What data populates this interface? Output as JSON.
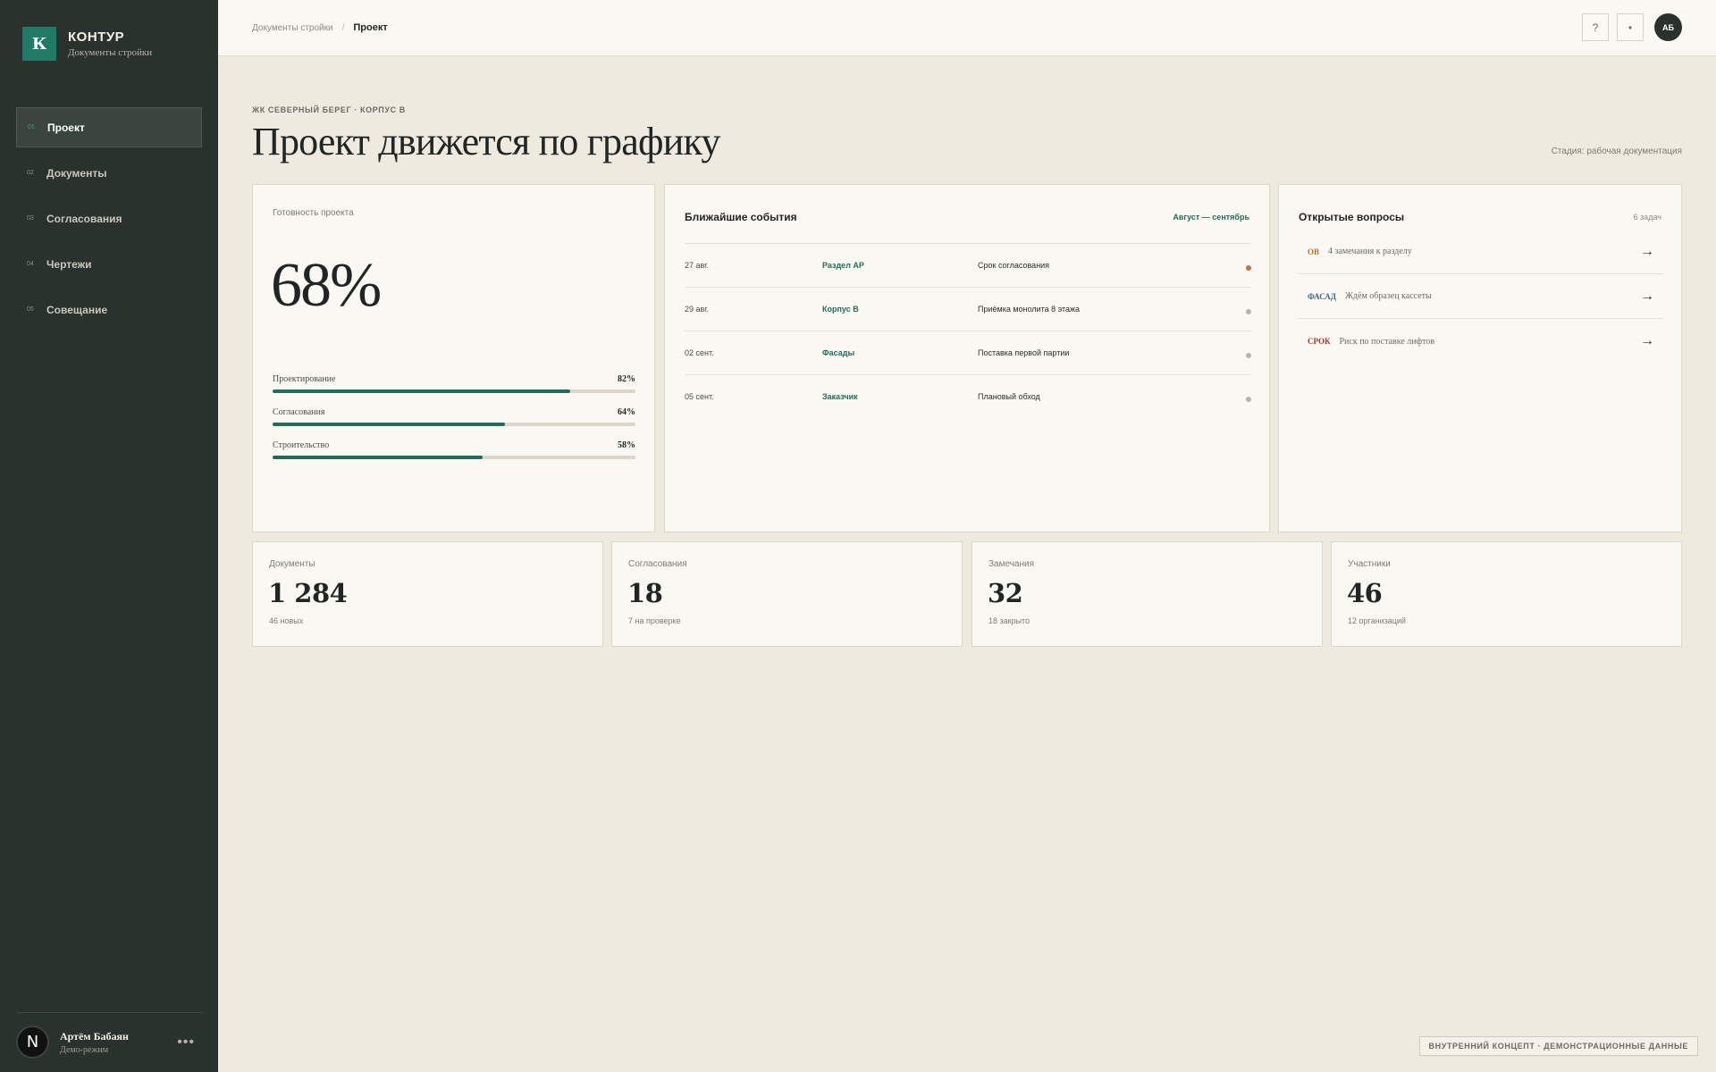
{
  "brand": {
    "logo_letter": "К",
    "name": "КОНТУР",
    "subtitle": "Документы стройки"
  },
  "nav": [
    {
      "num": "01",
      "label": "Проект",
      "active": true
    },
    {
      "num": "02",
      "label": "Документы"
    },
    {
      "num": "03",
      "label": "Согласования"
    },
    {
      "num": "04",
      "label": "Чертежи"
    },
    {
      "num": "05",
      "label": "Совещание"
    }
  ],
  "user": {
    "avatar": "N",
    "name": "Артём Бабаян",
    "role": "Демо-режим",
    "more": "•••"
  },
  "header": {
    "crumb_root": "Документы стройки",
    "crumb_sep": "/",
    "crumb_current": "Проект",
    "help": "?",
    "notify": "•",
    "avatar": "АБ"
  },
  "page": {
    "eyebrow": "ЖК СЕВЕРНЫЙ БЕРЕГ · КОРПУС B",
    "title": "Проект движется по графику",
    "stage": "Стадия: рабочая документация"
  },
  "readiness": {
    "label": "Готовность проекта",
    "value": "68%",
    "bars": [
      {
        "label": "Проектирование",
        "value": "82%",
        "fraction": 0.82
      },
      {
        "label": "Согласования",
        "value": "64%",
        "fraction": 0.64
      },
      {
        "label": "Строительство",
        "value": "58%",
        "fraction": 0.58
      }
    ]
  },
  "events": {
    "title": "Ближайшие события",
    "range": "Август — сентябрь",
    "items": [
      {
        "date": "27 авг.",
        "tag": "Раздел АР",
        "desc": "Срок согласования",
        "status": "hot"
      },
      {
        "date": "29 авг.",
        "tag": "Корпус B",
        "desc": "Приёмка монолита 8 этажа",
        "status": "normal"
      },
      {
        "date": "02 сент.",
        "tag": "Фасады",
        "desc": "Поставка первой партии",
        "status": "normal"
      },
      {
        "date": "05 сент.",
        "tag": "Заказчик",
        "desc": "Плановый обход",
        "status": "normal"
      }
    ]
  },
  "issues": {
    "title": "Открытые вопросы",
    "count": "6 задач",
    "items": [
      {
        "tag": "ОВ",
        "text": "4 замечания к разделу",
        "color": "#b0762a",
        "arrow": "→"
      },
      {
        "tag": "ФАСАД",
        "text": "Ждём образец кассеты",
        "color": "#3e6b8a",
        "arrow": "→"
      },
      {
        "tag": "СРОК",
        "text": "Риск по поставке лифтов",
        "color": "#a0392b",
        "arrow": "→"
      }
    ]
  },
  "stats": [
    {
      "label": "Документы",
      "value": "1 284",
      "sub": "46 новых"
    },
    {
      "label": "Согласования",
      "value": "18",
      "sub": "7 на проверке"
    },
    {
      "label": "Замечания",
      "value": "32",
      "sub": "18 закрыто"
    },
    {
      "label": "Участники",
      "value": "46",
      "sub": "12 организаций"
    }
  ],
  "footer_note": "ВНУТРЕННИЙ КОНЦЕПТ · ДЕМОНСТРАЦИОННЫЕ ДАННЫЕ"
}
